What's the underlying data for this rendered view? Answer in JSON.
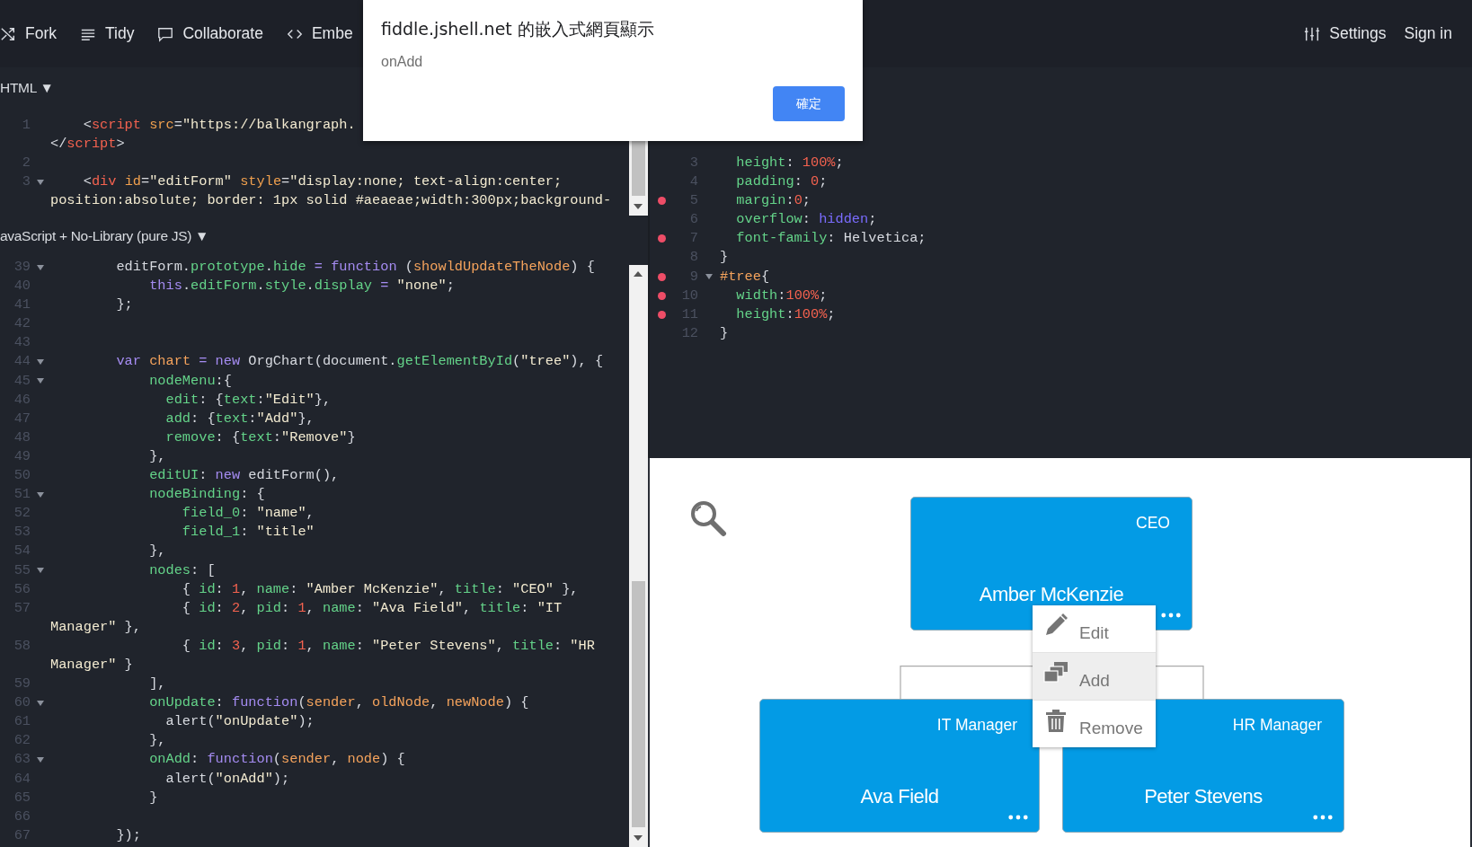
{
  "toolbar": {
    "left": [
      {
        "kind": "fork",
        "label": "Fork"
      },
      {
        "kind": "tidy",
        "label": "Tidy"
      },
      {
        "kind": "collaborate",
        "label": "Collaborate"
      },
      {
        "kind": "embed",
        "label": "Embe"
      }
    ],
    "right": [
      {
        "kind": "settings",
        "label": "Settings"
      },
      {
        "kind": "none",
        "label": "Sign in"
      }
    ]
  },
  "html": {
    "header": "HTML",
    "caret": "▼",
    "lines": [
      {
        "number": "1",
        "fold": false,
        "segments": [
          {
            "kind": "plain",
            "text": "    <"
          },
          {
            "kind": "tag",
            "text": "script"
          },
          {
            "kind": "attr",
            "text": " src"
          },
          {
            "kind": "plain",
            "text": "="
          },
          {
            "kind": "str",
            "text": "\"https://balkangraph."
          }
        ],
        "wrap": [
          {
            "kind": "plain",
            "text": "</"
          },
          {
            "kind": "tag",
            "text": "script"
          },
          {
            "kind": "plain",
            "text": ">"
          }
        ]
      },
      {
        "number": "2",
        "fold": false
      },
      {
        "number": "3",
        "fold": true,
        "segments": [
          {
            "kind": "plain",
            "text": "    <"
          },
          {
            "kind": "tag",
            "text": "div"
          },
          {
            "kind": "attr",
            "text": " id"
          },
          {
            "kind": "plain",
            "text": "="
          },
          {
            "kind": "str",
            "text": "\"editForm\""
          },
          {
            "kind": "attr",
            "text": " style"
          },
          {
            "kind": "plain",
            "text": "="
          },
          {
            "kind": "str",
            "text": "\"display:none; text-align:center;"
          }
        ],
        "wrap": [
          {
            "kind": "str",
            "text": "position:absolute; border: 1px solid #aeaeae;width:300px;background-"
          }
        ]
      }
    ]
  },
  "js": {
    "header": "avaScript + No-Library (pure JS)",
    "caret": "▼",
    "lines": [
      {
        "number": "39",
        "fold": true,
        "segments": [
          {
            "kind": "plain",
            "text": "        editForm."
          },
          {
            "kind": "prop",
            "text": "prototype"
          },
          {
            "kind": "plain",
            "text": "."
          },
          {
            "kind": "prop",
            "text": "hide"
          },
          {
            "kind": "kw",
            "text": " = function"
          },
          {
            "kind": "plain",
            "text": " ("
          },
          {
            "kind": "param",
            "text": "showldUpdateTheNode"
          },
          {
            "kind": "plain",
            "text": ") {"
          }
        ]
      },
      {
        "number": "40",
        "fold": false,
        "segments": [
          {
            "kind": "kw",
            "text": "            this"
          },
          {
            "kind": "plain",
            "text": "."
          },
          {
            "kind": "prop",
            "text": "editForm"
          },
          {
            "kind": "plain",
            "text": "."
          },
          {
            "kind": "prop",
            "text": "style"
          },
          {
            "kind": "plain",
            "text": "."
          },
          {
            "kind": "prop",
            "text": "display"
          },
          {
            "kind": "kw",
            "text": " = "
          },
          {
            "kind": "str",
            "text": "\"none\""
          },
          {
            "kind": "plain",
            "text": ";"
          }
        ]
      },
      {
        "number": "41",
        "fold": false,
        "segments": [
          {
            "kind": "plain",
            "text": "        };"
          }
        ]
      },
      {
        "number": "42",
        "fold": false
      },
      {
        "number": "43",
        "fold": false
      },
      {
        "number": "44",
        "fold": true,
        "segments": [
          {
            "kind": "kw",
            "text": "        var"
          },
          {
            "kind": "param",
            "text": " chart"
          },
          {
            "kind": "kw",
            "text": " = new"
          },
          {
            "kind": "plain",
            "text": " OrgChart(document."
          },
          {
            "kind": "prop",
            "text": "getElementById"
          },
          {
            "kind": "plain",
            "text": "("
          },
          {
            "kind": "str",
            "text": "\"tree\""
          },
          {
            "kind": "plain",
            "text": "), {"
          }
        ]
      },
      {
        "number": "45",
        "fold": true,
        "segments": [
          {
            "kind": "prop",
            "text": "            nodeMenu"
          },
          {
            "kind": "plain",
            "text": ":{"
          }
        ]
      },
      {
        "number": "46",
        "fold": false,
        "segments": [
          {
            "kind": "prop",
            "text": "              edit"
          },
          {
            "kind": "plain",
            "text": ": {"
          },
          {
            "kind": "prop",
            "text": "text"
          },
          {
            "kind": "plain",
            "text": ":"
          },
          {
            "kind": "str",
            "text": "\"Edit\""
          },
          {
            "kind": "plain",
            "text": "},"
          }
        ]
      },
      {
        "number": "47",
        "fold": false,
        "segments": [
          {
            "kind": "prop",
            "text": "              add"
          },
          {
            "kind": "plain",
            "text": ": {"
          },
          {
            "kind": "prop",
            "text": "text"
          },
          {
            "kind": "plain",
            "text": ":"
          },
          {
            "kind": "str",
            "text": "\"Add\""
          },
          {
            "kind": "plain",
            "text": "},"
          }
        ]
      },
      {
        "number": "48",
        "fold": false,
        "segments": [
          {
            "kind": "prop",
            "text": "              remove"
          },
          {
            "kind": "plain",
            "text": ": {"
          },
          {
            "kind": "prop",
            "text": "text"
          },
          {
            "kind": "plain",
            "text": ":"
          },
          {
            "kind": "str",
            "text": "\"Remove\""
          },
          {
            "kind": "plain",
            "text": "}"
          }
        ]
      },
      {
        "number": "49",
        "fold": false,
        "segments": [
          {
            "kind": "plain",
            "text": "            },"
          }
        ]
      },
      {
        "number": "50",
        "fold": false,
        "segments": [
          {
            "kind": "prop",
            "text": "            editUI"
          },
          {
            "kind": "plain",
            "text": ": "
          },
          {
            "kind": "kw",
            "text": "new"
          },
          {
            "kind": "plain",
            "text": " editForm(),"
          }
        ]
      },
      {
        "number": "51",
        "fold": true,
        "segments": [
          {
            "kind": "prop",
            "text": "            nodeBinding"
          },
          {
            "kind": "plain",
            "text": ": {"
          }
        ]
      },
      {
        "number": "52",
        "fold": false,
        "segments": [
          {
            "kind": "prop",
            "text": "                field_0"
          },
          {
            "kind": "plain",
            "text": ": "
          },
          {
            "kind": "str",
            "text": "\"name\""
          },
          {
            "kind": "plain",
            "text": ","
          }
        ]
      },
      {
        "number": "53",
        "fold": false,
        "segments": [
          {
            "kind": "prop",
            "text": "                field_1"
          },
          {
            "kind": "plain",
            "text": ": "
          },
          {
            "kind": "str",
            "text": "\"title\""
          }
        ]
      },
      {
        "number": "54",
        "fold": false,
        "segments": [
          {
            "kind": "plain",
            "text": "            },"
          }
        ]
      },
      {
        "number": "55",
        "fold": true,
        "segments": [
          {
            "kind": "prop",
            "text": "            nodes"
          },
          {
            "kind": "plain",
            "text": ": ["
          }
        ]
      },
      {
        "number": "56",
        "fold": false,
        "segments": [
          {
            "kind": "plain",
            "text": "                { "
          },
          {
            "kind": "prop",
            "text": "id"
          },
          {
            "kind": "plain",
            "text": ": "
          },
          {
            "kind": "num",
            "text": "1"
          },
          {
            "kind": "plain",
            "text": ", "
          },
          {
            "kind": "prop",
            "text": "name"
          },
          {
            "kind": "plain",
            "text": ": "
          },
          {
            "kind": "str",
            "text": "\"Amber McKenzie\""
          },
          {
            "kind": "plain",
            "text": ", "
          },
          {
            "kind": "prop",
            "text": "title"
          },
          {
            "kind": "plain",
            "text": ": "
          },
          {
            "kind": "str",
            "text": "\"CEO\""
          },
          {
            "kind": "plain",
            "text": " },"
          }
        ]
      },
      {
        "number": "57",
        "fold": false,
        "segments": [
          {
            "kind": "plain",
            "text": "                { "
          },
          {
            "kind": "prop",
            "text": "id"
          },
          {
            "kind": "plain",
            "text": ": "
          },
          {
            "kind": "num",
            "text": "2"
          },
          {
            "kind": "plain",
            "text": ", "
          },
          {
            "kind": "prop",
            "text": "pid"
          },
          {
            "kind": "plain",
            "text": ": "
          },
          {
            "kind": "num",
            "text": "1"
          },
          {
            "kind": "plain",
            "text": ", "
          },
          {
            "kind": "prop",
            "text": "name"
          },
          {
            "kind": "plain",
            "text": ": "
          },
          {
            "kind": "str",
            "text": "\"Ava Field\""
          },
          {
            "kind": "plain",
            "text": ", "
          },
          {
            "kind": "prop",
            "text": "title"
          },
          {
            "kind": "plain",
            "text": ": "
          },
          {
            "kind": "str",
            "text": "\"IT"
          }
        ],
        "wrap": [
          {
            "kind": "str",
            "text": "Manager\""
          },
          {
            "kind": "plain",
            "text": " },"
          }
        ]
      },
      {
        "number": "58",
        "fold": false,
        "segments": [
          {
            "kind": "plain",
            "text": "                { "
          },
          {
            "kind": "prop",
            "text": "id"
          },
          {
            "kind": "plain",
            "text": ": "
          },
          {
            "kind": "num",
            "text": "3"
          },
          {
            "kind": "plain",
            "text": ", "
          },
          {
            "kind": "prop",
            "text": "pid"
          },
          {
            "kind": "plain",
            "text": ": "
          },
          {
            "kind": "num",
            "text": "1"
          },
          {
            "kind": "plain",
            "text": ", "
          },
          {
            "kind": "prop",
            "text": "name"
          },
          {
            "kind": "plain",
            "text": ": "
          },
          {
            "kind": "str",
            "text": "\"Peter Stevens\""
          },
          {
            "kind": "plain",
            "text": ", "
          },
          {
            "kind": "prop",
            "text": "title"
          },
          {
            "kind": "plain",
            "text": ": "
          },
          {
            "kind": "str",
            "text": "\"HR"
          }
        ],
        "wrap": [
          {
            "kind": "str",
            "text": "Manager\""
          },
          {
            "kind": "plain",
            "text": " }"
          }
        ]
      },
      {
        "number": "59",
        "fold": false,
        "segments": [
          {
            "kind": "plain",
            "text": "            ],"
          }
        ]
      },
      {
        "number": "60",
        "fold": true,
        "segments": [
          {
            "kind": "prop",
            "text": "            onUpdate"
          },
          {
            "kind": "plain",
            "text": ": "
          },
          {
            "kind": "kw",
            "text": "function"
          },
          {
            "kind": "plain",
            "text": "("
          },
          {
            "kind": "param",
            "text": "sender"
          },
          {
            "kind": "plain",
            "text": ", "
          },
          {
            "kind": "param",
            "text": "oldNode"
          },
          {
            "kind": "plain",
            "text": ", "
          },
          {
            "kind": "param",
            "text": "newNode"
          },
          {
            "kind": "plain",
            "text": ") {"
          }
        ]
      },
      {
        "number": "61",
        "fold": false,
        "segments": [
          {
            "kind": "plain",
            "text": "              alert("
          },
          {
            "kind": "str",
            "text": "\"onUpdate\""
          },
          {
            "kind": "plain",
            "text": ");"
          }
        ]
      },
      {
        "number": "62",
        "fold": false,
        "segments": [
          {
            "kind": "plain",
            "text": "            },"
          }
        ]
      },
      {
        "number": "63",
        "fold": true,
        "segments": [
          {
            "kind": "prop",
            "text": "            onAdd"
          },
          {
            "kind": "plain",
            "text": ": "
          },
          {
            "kind": "kw",
            "text": "function"
          },
          {
            "kind": "plain",
            "text": "("
          },
          {
            "kind": "param",
            "text": "sender"
          },
          {
            "kind": "plain",
            "text": ", "
          },
          {
            "kind": "param",
            "text": "node"
          },
          {
            "kind": "plain",
            "text": ") {"
          }
        ]
      },
      {
        "number": "64",
        "fold": false,
        "segments": [
          {
            "kind": "plain",
            "text": "              alert("
          },
          {
            "kind": "str",
            "text": "\"onAdd\""
          },
          {
            "kind": "plain",
            "text": ");"
          }
        ]
      },
      {
        "number": "65",
        "fold": false,
        "segments": [
          {
            "kind": "plain",
            "text": "            }"
          }
        ]
      },
      {
        "number": "66",
        "fold": false
      },
      {
        "number": "67",
        "fold": false,
        "segments": [
          {
            "kind": "plain",
            "text": "        });"
          }
        ]
      }
    ]
  },
  "css": {
    "lines": [
      {
        "number": "3",
        "fold": false,
        "error": false,
        "segments": [
          {
            "kind": "prop",
            "text": "  height"
          },
          {
            "kind": "plain",
            "text": ": "
          },
          {
            "kind": "num",
            "text": "100%"
          },
          {
            "kind": "plain",
            "text": ";"
          }
        ]
      },
      {
        "number": "4",
        "fold": false,
        "error": false,
        "segments": [
          {
            "kind": "prop",
            "text": "  padding"
          },
          {
            "kind": "plain",
            "text": ": "
          },
          {
            "kind": "num",
            "text": "0"
          },
          {
            "kind": "plain",
            "text": ";"
          }
        ]
      },
      {
        "number": "5",
        "fold": false,
        "error": true,
        "segments": [
          {
            "kind": "prop",
            "text": "  margin"
          },
          {
            "kind": "plain",
            "text": ":"
          },
          {
            "kind": "num",
            "text": "0"
          },
          {
            "kind": "plain",
            "text": ";"
          }
        ]
      },
      {
        "number": "6",
        "fold": false,
        "error": false,
        "segments": [
          {
            "kind": "prop",
            "text": "  overflow"
          },
          {
            "kind": "plain",
            "text": ": "
          },
          {
            "kind": "const",
            "text": "hidden"
          },
          {
            "kind": "plain",
            "text": ";"
          }
        ]
      },
      {
        "number": "7",
        "fold": false,
        "error": true,
        "segments": [
          {
            "kind": "prop",
            "text": "  font-family"
          },
          {
            "kind": "plain",
            "text": ": Helvetica;"
          }
        ]
      },
      {
        "number": "8",
        "fold": false,
        "error": false,
        "segments": [
          {
            "kind": "plain",
            "text": "}"
          }
        ]
      },
      {
        "number": "9",
        "fold": true,
        "error": true,
        "segments": [
          {
            "kind": "param",
            "text": "#tree"
          },
          {
            "kind": "plain",
            "text": "{"
          }
        ]
      },
      {
        "number": "10",
        "fold": false,
        "error": true,
        "segments": [
          {
            "kind": "prop",
            "text": "  width"
          },
          {
            "kind": "plain",
            "text": ":"
          },
          {
            "kind": "num",
            "text": "100%"
          },
          {
            "kind": "plain",
            "text": ";"
          }
        ]
      },
      {
        "number": "11",
        "fold": false,
        "error": true,
        "segments": [
          {
            "kind": "prop",
            "text": "  height"
          },
          {
            "kind": "plain",
            "text": ":"
          },
          {
            "kind": "num",
            "text": "100%"
          },
          {
            "kind": "plain",
            "text": ";"
          }
        ]
      },
      {
        "number": "12",
        "fold": false,
        "error": false,
        "segments": [
          {
            "kind": "plain",
            "text": "}"
          }
        ]
      }
    ]
  },
  "result": {
    "nodes": [
      {
        "title": "CEO",
        "name": "Amber McKenzie"
      },
      {
        "title": "IT Manager",
        "name": "Ava Field"
      },
      {
        "title": "HR Manager",
        "name": "Peter Stevens"
      }
    ],
    "menu": [
      {
        "kind": "edit",
        "label": "Edit",
        "selected": false
      },
      {
        "kind": "add",
        "label": "Add",
        "selected": true
      },
      {
        "kind": "remove",
        "label": "Remove",
        "selected": false
      }
    ]
  },
  "dialog": {
    "title": "fiddle.jshell.net 的嵌入式網頁顯示",
    "message": "onAdd",
    "button": "確定"
  }
}
